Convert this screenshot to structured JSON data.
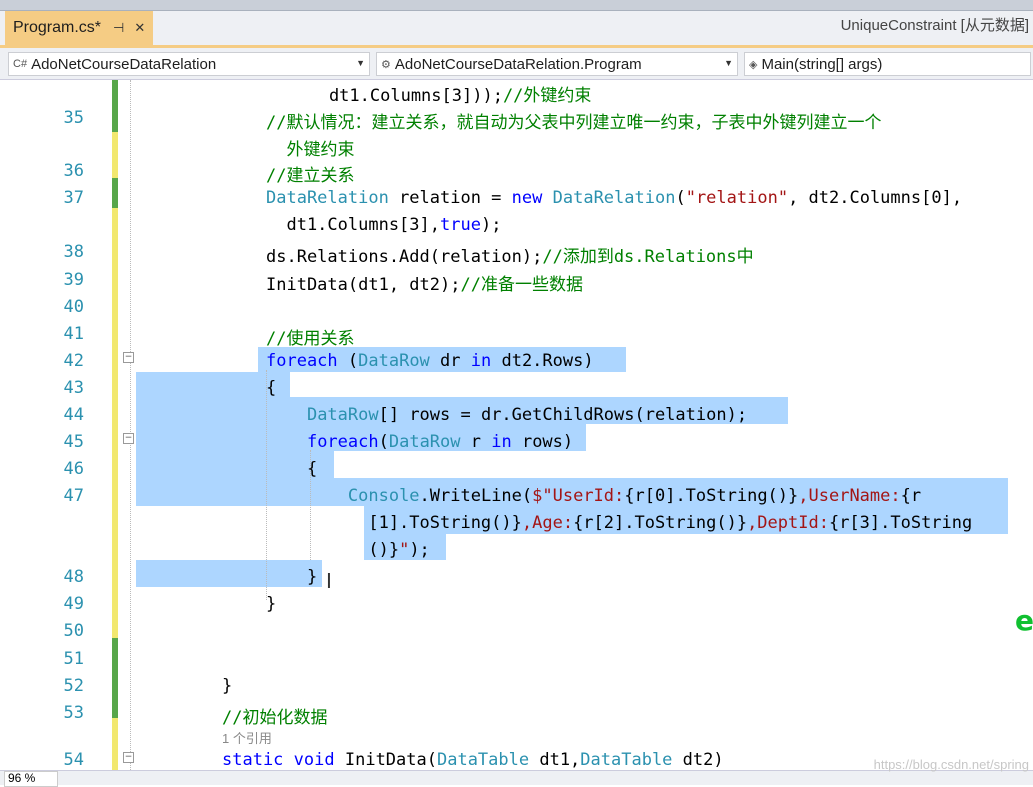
{
  "tabs": {
    "active": "Program.cs*",
    "pin_icon": "pin-icon",
    "close_icon": "close-icon"
  },
  "window_title": "UniqueConstraint [从元数据]",
  "navigation": {
    "project": "AdoNetCourseDataRelation",
    "class": "AdoNetCourseDataRelation.Program",
    "member": "Main(string[] args)"
  },
  "lines": [
    {
      "n": "",
      "segs": [
        [
          "t",
          "    dt1.Columns[3]));"
        ],
        [
          "c",
          "//外键约束"
        ]
      ]
    },
    {
      "n": "35",
      "segs": [
        [
          "c",
          "//默认情况：建立关系，就自动为父表中列建立唯一约束，子表中外键列建立一个"
        ]
      ]
    },
    {
      "n": "",
      "segs": [
        [
          "c",
          "  外键约束"
        ]
      ]
    },
    {
      "n": "36",
      "segs": [
        [
          "c",
          "//建立关系"
        ]
      ]
    },
    {
      "n": "37",
      "segs": [
        [
          "y",
          "DataRelation"
        ],
        [
          "t",
          " relation = "
        ],
        [
          "k",
          "new"
        ],
        [
          "t",
          " "
        ],
        [
          "y",
          "DataRelation"
        ],
        [
          "t",
          "("
        ],
        [
          "s",
          "\"relation\""
        ],
        [
          "t",
          ", dt2.Columns[0],"
        ]
      ]
    },
    {
      "n": "",
      "segs": [
        [
          "t",
          "  dt1.Columns[3],"
        ],
        [
          "k",
          "true"
        ],
        [
          "t",
          ");"
        ]
      ]
    },
    {
      "n": "38",
      "segs": [
        [
          "t",
          "ds.Relations.Add(relation);"
        ],
        [
          "c",
          "//添加到ds.Relations中"
        ]
      ]
    },
    {
      "n": "39",
      "segs": [
        [
          "t",
          "InitData(dt1, dt2);"
        ],
        [
          "c",
          "//准备一些数据"
        ]
      ]
    },
    {
      "n": "40",
      "segs": []
    },
    {
      "n": "41",
      "segs": [
        [
          "c",
          "//使用关系"
        ]
      ]
    },
    {
      "n": "42",
      "segs": [
        [
          "k",
          "foreach"
        ],
        [
          "t",
          " ("
        ],
        [
          "y",
          "DataRow"
        ],
        [
          "t",
          " dr "
        ],
        [
          "k",
          "in"
        ],
        [
          "t",
          " dt2.Rows)"
        ]
      ]
    },
    {
      "n": "43",
      "segs": [
        [
          "t",
          "{"
        ]
      ]
    },
    {
      "n": "44",
      "segs": [
        [
          "t",
          "    "
        ],
        [
          "y",
          "DataRow"
        ],
        [
          "t",
          "[] rows = dr.GetChildRows(relation);"
        ]
      ]
    },
    {
      "n": "45",
      "segs": [
        [
          "t",
          "    "
        ],
        [
          "k",
          "foreach"
        ],
        [
          "t",
          "("
        ],
        [
          "y",
          "DataRow"
        ],
        [
          "t",
          " r "
        ],
        [
          "k",
          "in"
        ],
        [
          "t",
          " rows)"
        ]
      ]
    },
    {
      "n": "46",
      "segs": [
        [
          "t",
          "    {"
        ]
      ]
    },
    {
      "n": "47",
      "segs": [
        [
          "t",
          "        "
        ],
        [
          "y",
          "Console"
        ],
        [
          "t",
          ".WriteLine("
        ],
        [
          "s",
          "$\"UserId:"
        ],
        [
          "t",
          "{r[0].ToString()}"
        ],
        [
          "s",
          ",UserName:"
        ],
        [
          "t",
          "{r"
        ]
      ]
    },
    {
      "n": "",
      "segs": [
        [
          "t",
          "          [1].ToString()}"
        ],
        [
          "s",
          ",Age:"
        ],
        [
          "t",
          "{r[2].ToString()}"
        ],
        [
          "s",
          ",DeptId:"
        ],
        [
          "t",
          "{r[3].ToString"
        ]
      ]
    },
    {
      "n": "",
      "segs": [
        [
          "t",
          "          ()}"
        ],
        [
          "s",
          "\""
        ],
        [
          "t",
          ");"
        ]
      ]
    },
    {
      "n": "48",
      "segs": [
        [
          "t",
          "    }"
        ]
      ]
    },
    {
      "n": "49",
      "segs": [
        [
          "t",
          "}"
        ]
      ]
    },
    {
      "n": "50",
      "segs": []
    },
    {
      "n": "51",
      "segs": []
    },
    {
      "n": "52",
      "segs": [
        [
          "t",
          "}"
        ]
      ]
    },
    {
      "n": "53",
      "segs": [
        [
          "c",
          "//初始化数据"
        ]
      ]
    },
    {
      "n": "",
      "segs": [
        [
          "r",
          "1 个引用"
        ]
      ]
    },
    {
      "n": "54",
      "segs": [
        [
          "k",
          "static"
        ],
        [
          "t",
          " "
        ],
        [
          "k",
          "void"
        ],
        [
          "t",
          " InitData("
        ],
        [
          "y",
          "DataTable"
        ],
        [
          "t",
          " dt1,"
        ],
        [
          "y",
          "DataTable"
        ],
        [
          "t",
          " dt2)"
        ]
      ]
    }
  ],
  "status": {
    "zoom": "96 %"
  },
  "watermark": "https://blog.csdn.net/spring",
  "colors": {
    "keyword": "#0000ff",
    "type": "#2b91af",
    "comment": "#008000",
    "string": "#a31515",
    "selection": "#add6ff",
    "line_number": "#2b91af",
    "active_tab": "#f5cc84"
  }
}
